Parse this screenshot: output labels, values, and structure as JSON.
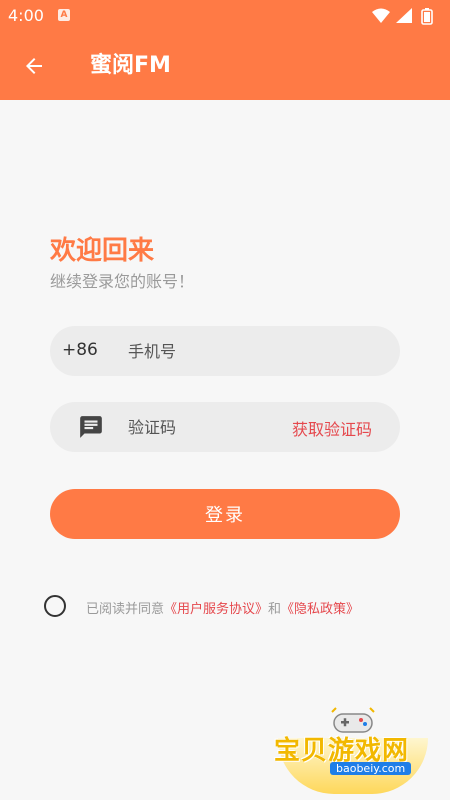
{
  "status_bar": {
    "time": "4:00",
    "notification_glyph": "A",
    "icons": [
      "wifi-icon",
      "signal-icon",
      "battery-icon"
    ]
  },
  "app_bar": {
    "back_icon": "arrow-left-icon",
    "title": "蜜阅FM"
  },
  "welcome": {
    "title": "欢迎回来",
    "subtitle": "继续登录您的账号！"
  },
  "phone_field": {
    "country_code": "+86",
    "placeholder": "手机号",
    "value": ""
  },
  "code_field": {
    "icon": "message-icon",
    "placeholder": "验证码",
    "value": "",
    "get_code_label": "获取验证码"
  },
  "login_button": {
    "label": "登录"
  },
  "agreement": {
    "checked": false,
    "prefix": "已阅读并同意",
    "terms_link": "《用户服务协议》",
    "conjunction": "和",
    "privacy_link": "《隐私政策》"
  },
  "watermark": {
    "name": "宝贝游戏网",
    "domain": "baobeiy.com"
  },
  "colors": {
    "primary": "#ff7a45",
    "link": "#e5484d",
    "background": "#f7f7f7",
    "field_bg": "#ececec"
  }
}
